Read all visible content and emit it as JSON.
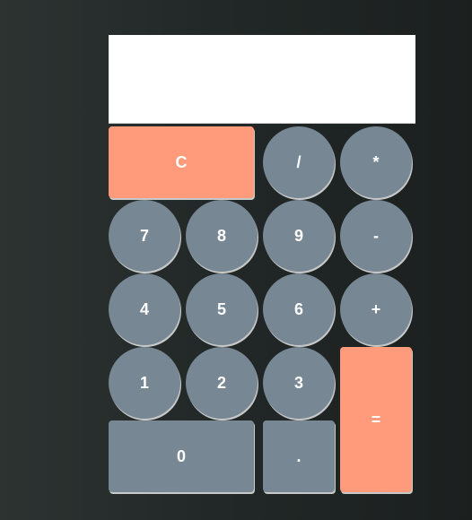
{
  "display": {
    "value": ""
  },
  "keys": {
    "clear": "C",
    "divide": "/",
    "multiply": "*",
    "seven": "7",
    "eight": "8",
    "nine": "9",
    "minus": "-",
    "four": "4",
    "five": "5",
    "six": "6",
    "plus": "+",
    "one": "1",
    "two": "2",
    "three": "3",
    "equals": "=",
    "zero": "0",
    "decimal": "."
  },
  "colors": {
    "background": "#222827",
    "display_bg": "#ffffff",
    "number_key": "#778894",
    "accent_key": "#ff9b7b",
    "key_text": "#ffffff"
  }
}
